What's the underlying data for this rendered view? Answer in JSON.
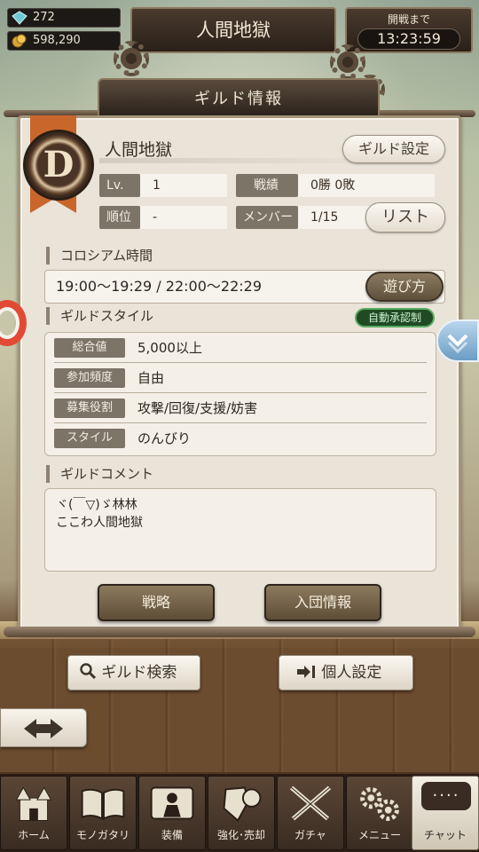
{
  "header": {
    "gems": "272",
    "coins": "598,290",
    "title": "人間地獄",
    "timer_label": "開戦まで",
    "timer_value": "13:23:59"
  },
  "panel": {
    "banner": "ギルド情報",
    "emblem_letter": "D",
    "guild_name": "人間地獄",
    "settings_button": "ギルド設定",
    "stats": {
      "level_label": "Lv.",
      "level_value": "1",
      "record_label": "戦績",
      "record_value": "0勝 0敗",
      "rank_label": "順位",
      "rank_value": "-",
      "members_label": "メンバー",
      "members_value": "1/15",
      "list_button": "リスト"
    },
    "colosseum": {
      "title": "コロシアム時間",
      "times": "19:00〜19:29  /  22:00〜22:29",
      "how_to_button": "遊び方"
    },
    "style": {
      "title": "ギルドスタイル",
      "badge": "自動承認制",
      "rows": [
        {
          "label": "総合値",
          "value": "5,000以上"
        },
        {
          "label": "参加頻度",
          "value": "自由"
        },
        {
          "label": "募集役割",
          "value": "攻撃/回復/支援/妨害"
        },
        {
          "label": "スタイル",
          "value": "のんびり"
        }
      ]
    },
    "comment": {
      "title": "ギルドコメント",
      "line1": "ヾ(￣▽)ゞ林林",
      "line2": "ここわ人間地獄"
    },
    "strategy_button": "戦略",
    "join_info_button": "入団情報"
  },
  "actions": {
    "search_button": "ギルド検索",
    "personal_button": "個人設定"
  },
  "nav": {
    "items": [
      {
        "label": "ホーム",
        "icon": "castle-icon"
      },
      {
        "label": "モノガタリ",
        "icon": "book-icon"
      },
      {
        "label": "装備",
        "icon": "armor-icon"
      },
      {
        "label": "強化･売却",
        "icon": "shield-upgrade-icon"
      },
      {
        "label": "ガチャ",
        "icon": "crossed-swords-icon"
      },
      {
        "label": "メニュー",
        "icon": "gears-icon"
      }
    ],
    "chat_bubble": "....",
    "chat_label": "チャット"
  }
}
